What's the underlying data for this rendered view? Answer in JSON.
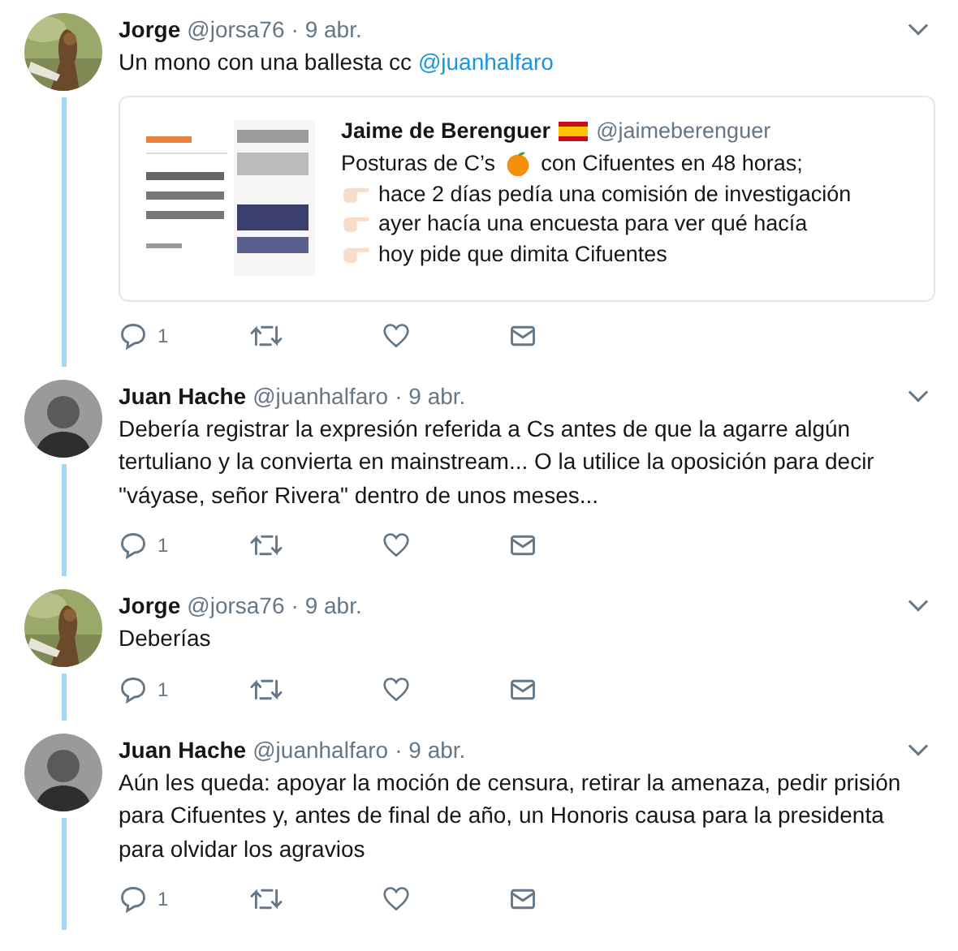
{
  "tweets": [
    {
      "name": "Jorge",
      "handle": "@jorsa76",
      "date": "· 9 abr.",
      "avatar": {
        "kind": "picture"
      },
      "body": [
        {
          "kind": "plain",
          "text": "Un mono con una ballesta cc"
        },
        {
          "kind": "mention",
          "text": "@juanhalfaro"
        }
      ],
      "replies": "1",
      "quote": {
        "author": "Jaime de Berenguer",
        "handle": "@jaimeberenguer",
        "lines": [
          {
            "kind": "intro",
            "before": "Posturas de C’s",
            "after": "con Cifuentes en 48 horas;"
          },
          {
            "kind": "bullet",
            "text": "hace 2 días pedía una comisión de investigación"
          },
          {
            "kind": "bullet",
            "text": "ayer hacía una encuesta para ver qué hacía"
          },
          {
            "kind": "bullet",
            "text": "hoy pide que dimita Cifuentes"
          }
        ]
      }
    },
    {
      "name": "Juan Hache",
      "handle": "@juanhalfaro",
      "date": "· 9 abr.",
      "avatar": {
        "kind": "silhouette"
      },
      "body": [
        {
          "kind": "plain",
          "text": "Debería registrar la expresión referida a Cs antes de que la agarre algún tertuliano y la convierta en mainstream... O la utilice la oposición para decir \"váyase, señor Rivera\" dentro de unos meses..."
        }
      ],
      "replies": "1"
    },
    {
      "name": "Jorge",
      "handle": "@jorsa76",
      "date": "· 9 abr.",
      "avatar": {
        "kind": "picture"
      },
      "body": [
        {
          "kind": "plain",
          "text": "Deberías"
        }
      ],
      "replies": "1"
    },
    {
      "name": "Juan Hache",
      "handle": "@juanhalfaro",
      "date": "· 9 abr.",
      "avatar": {
        "kind": "silhouette"
      },
      "body": [
        {
          "kind": "plain",
          "text": "Aún les queda: apoyar la moción de censura, retirar la amenaza, pedir prisión para Cifuentes y, antes de final de año, un Honoris causa para la presidenta para olvidar los agravios"
        }
      ],
      "replies": "1"
    }
  ]
}
